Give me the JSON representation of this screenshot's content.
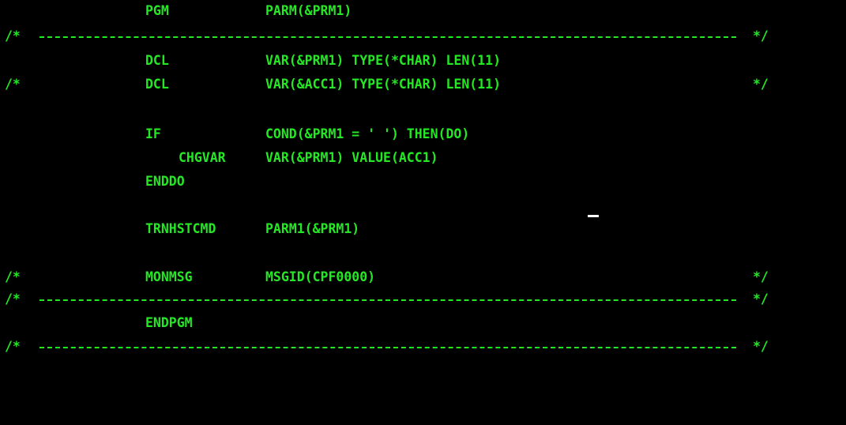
{
  "screen": {
    "colors": {
      "background": "#000000",
      "text": "#24e824",
      "cursor": "#ffffff"
    },
    "lines": {
      "pgm": {
        "command": "PGM",
        "parameters": "PARM(&PRM1)"
      },
      "separator_top": {
        "open": "/*",
        "close": "*/"
      },
      "dcl_prm": {
        "command": "DCL",
        "parameters": "VAR(&PRM1) TYPE(*CHAR) LEN(11)"
      },
      "dcl_acc": {
        "open": "/*",
        "command": "DCL",
        "parameters": "VAR(&ACC1) TYPE(*CHAR) LEN(11)",
        "close": "*/"
      },
      "if": {
        "command": "IF",
        "parameters": "COND(&PRM1 = ' ') THEN(DO)"
      },
      "chgvar": {
        "command": "CHGVAR",
        "parameters": "VAR(&PRM1) VALUE(ACC1)"
      },
      "enddo": {
        "command": "ENDDO"
      },
      "trnhstcmd": {
        "command": "TRNHSTCMD",
        "parameters": "PARM1(&PRM1)"
      },
      "monmsg": {
        "open": "/*",
        "command": "MONMSG",
        "parameters": "MSGID(CPF0000)",
        "close": "*/"
      },
      "separator_mid": {
        "open": "/*",
        "close": "*/"
      },
      "endpgm": {
        "command": "ENDPGM"
      },
      "separator_bottom": {
        "open": "/*",
        "close": "*/"
      }
    }
  }
}
